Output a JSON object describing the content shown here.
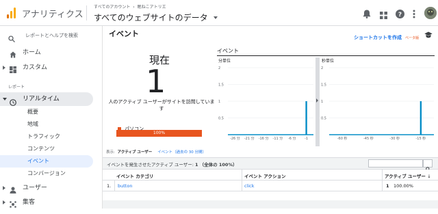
{
  "topbar": {
    "app_name": "アナリティクス",
    "breadcrumb_account": "すべてのアカウント",
    "breadcrumb_sep": "›",
    "breadcrumb_property": "眠ねこアトリエ",
    "view_title": "すべてのウェブサイトのデータ",
    "view_dropdown_icon": "caret-down-icon",
    "icons": [
      "bell-icon",
      "apps-grid-icon",
      "help-icon",
      "more-vert-icon",
      "avatar"
    ]
  },
  "sidebar": {
    "search_placeholder": "レポートとヘルプを検索",
    "home": "ホーム",
    "custom": "カスタム",
    "section_reports": "レポート",
    "realtime": "リアルタイム",
    "realtime_subitems": [
      "概要",
      "地域",
      "トラフィック",
      "コンテンツ",
      "イベント",
      "コンバージョン"
    ],
    "active_subitem": "イベント",
    "users": "ユーザー",
    "acquisition": "集客"
  },
  "page": {
    "title": "イベント",
    "shortcut_label": "ショートカットを作成",
    "beta_label": "ベータ版",
    "cap_icon": "graduation-cap-icon"
  },
  "now_panel": {
    "label": "現在",
    "count": "1",
    "description": "人のアクティブ ユーザーがサイトを訪問しています",
    "device_label": "パソコン",
    "device_percent": "100%",
    "device_fraction": 1.0,
    "device_color": "#e8551f"
  },
  "charts": {
    "title": "イベント",
    "minute_label": "分単位",
    "second_label": "秒単位",
    "bar_color": "#058dc7"
  },
  "chart_data": [
    {
      "type": "bar",
      "title": "分単位",
      "x_ticks": [
        "-26 分",
        "-21 分",
        "-16 分",
        "-11 分",
        "-6 分",
        "-1"
      ],
      "y_ticks": [
        "2",
        "1.5",
        "1",
        "0.5"
      ],
      "ylim": [
        0,
        2
      ],
      "categories": [
        "-1"
      ],
      "values": [
        1
      ]
    },
    {
      "type": "bar",
      "title": "秒単位",
      "x_ticks": [
        "-60 秒",
        "-45 秒",
        "-30 秒",
        "-15 秒"
      ],
      "y_ticks": [
        "2",
        "1.5",
        "1",
        "0.5"
      ],
      "ylim": [
        0,
        2
      ],
      "categories": [
        "-15 秒"
      ],
      "values": [
        1
      ]
    }
  ],
  "filter": {
    "display_label": "表示:",
    "active_tab": "アクティブ ユーザー",
    "other_tab": "イベント（過去の 30 分間）"
  },
  "table": {
    "summary_prefix": "イベントを発生させたアクティブ ユーザー:",
    "summary_value": "1",
    "summary_suffix": "（全体の 100%）",
    "search_icon": "search-icon",
    "headers": [
      "イベント カテゴリ",
      "イベント アクション",
      "アクティブ ユーザー"
    ],
    "sort_icon": "arrow-down-icon",
    "rows": [
      {
        "index": "1.",
        "category": "button",
        "action": "click",
        "users": "1",
        "percent": "100.00%"
      }
    ]
  }
}
